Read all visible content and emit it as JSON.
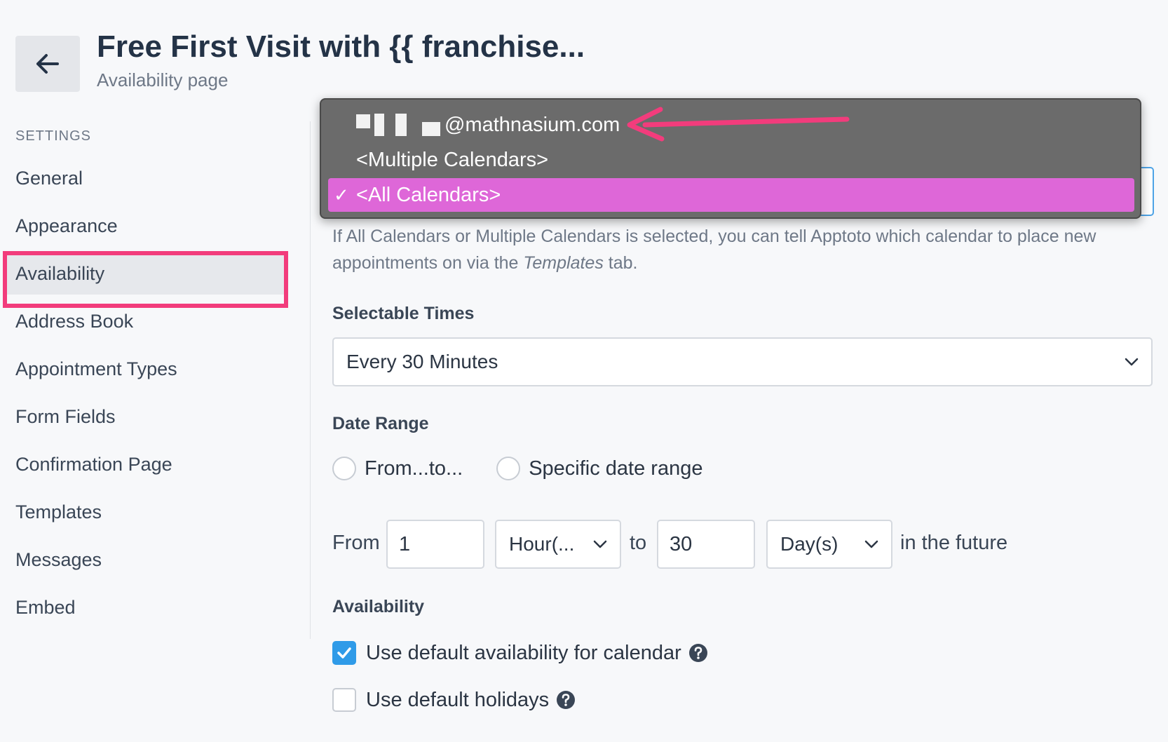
{
  "header": {
    "title": "Free First Visit with {{ franchise...",
    "subtitle": "Availability page"
  },
  "sidebar": {
    "heading": "SETTINGS",
    "items": [
      {
        "label": "General"
      },
      {
        "label": "Appearance"
      },
      {
        "label": "Availability",
        "active": true
      },
      {
        "label": "Address Book"
      },
      {
        "label": "Appointment Types"
      },
      {
        "label": "Form Fields"
      },
      {
        "label": "Confirmation Page"
      },
      {
        "label": "Templates"
      },
      {
        "label": "Messages"
      },
      {
        "label": "Embed"
      }
    ]
  },
  "calendar_dropdown": {
    "options": [
      {
        "label": "@mathnasium.com",
        "redacted_prefix": true
      },
      {
        "label": "<Multiple Calendars>"
      },
      {
        "label": "<All Calendars>",
        "selected": true
      }
    ],
    "check_mark": "✓"
  },
  "calendar_help": {
    "text_before": "If All Calendars or Multiple Calendars is selected, you can tell Apptoto which calendar to place new appointments on via the ",
    "emphasis": "Templates",
    "text_after": " tab."
  },
  "selectable_times": {
    "label": "Selectable Times",
    "value": "Every 30 Minutes"
  },
  "date_range": {
    "label": "Date Range",
    "options": [
      "From...to...",
      "Specific date range"
    ],
    "from_label": "From",
    "from_value": "1",
    "from_unit": "Hour(...",
    "to_label": "to",
    "to_value": "30",
    "to_unit": "Day(s)",
    "suffix": "in the future"
  },
  "availability": {
    "label": "Availability",
    "use_default_availability": {
      "label": "Use default availability for calendar",
      "checked": true
    },
    "use_default_holidays": {
      "label": "Use default holidays",
      "checked": false
    }
  },
  "colors": {
    "highlight_outline": "#f23c7c",
    "selected_option": "#de67d8",
    "checkbox_checked": "#2f9be8"
  },
  "icons": [
    "back-arrow-icon",
    "chevron-down-icon",
    "check-icon",
    "help-circle-icon",
    "annotation-arrow-icon"
  ]
}
